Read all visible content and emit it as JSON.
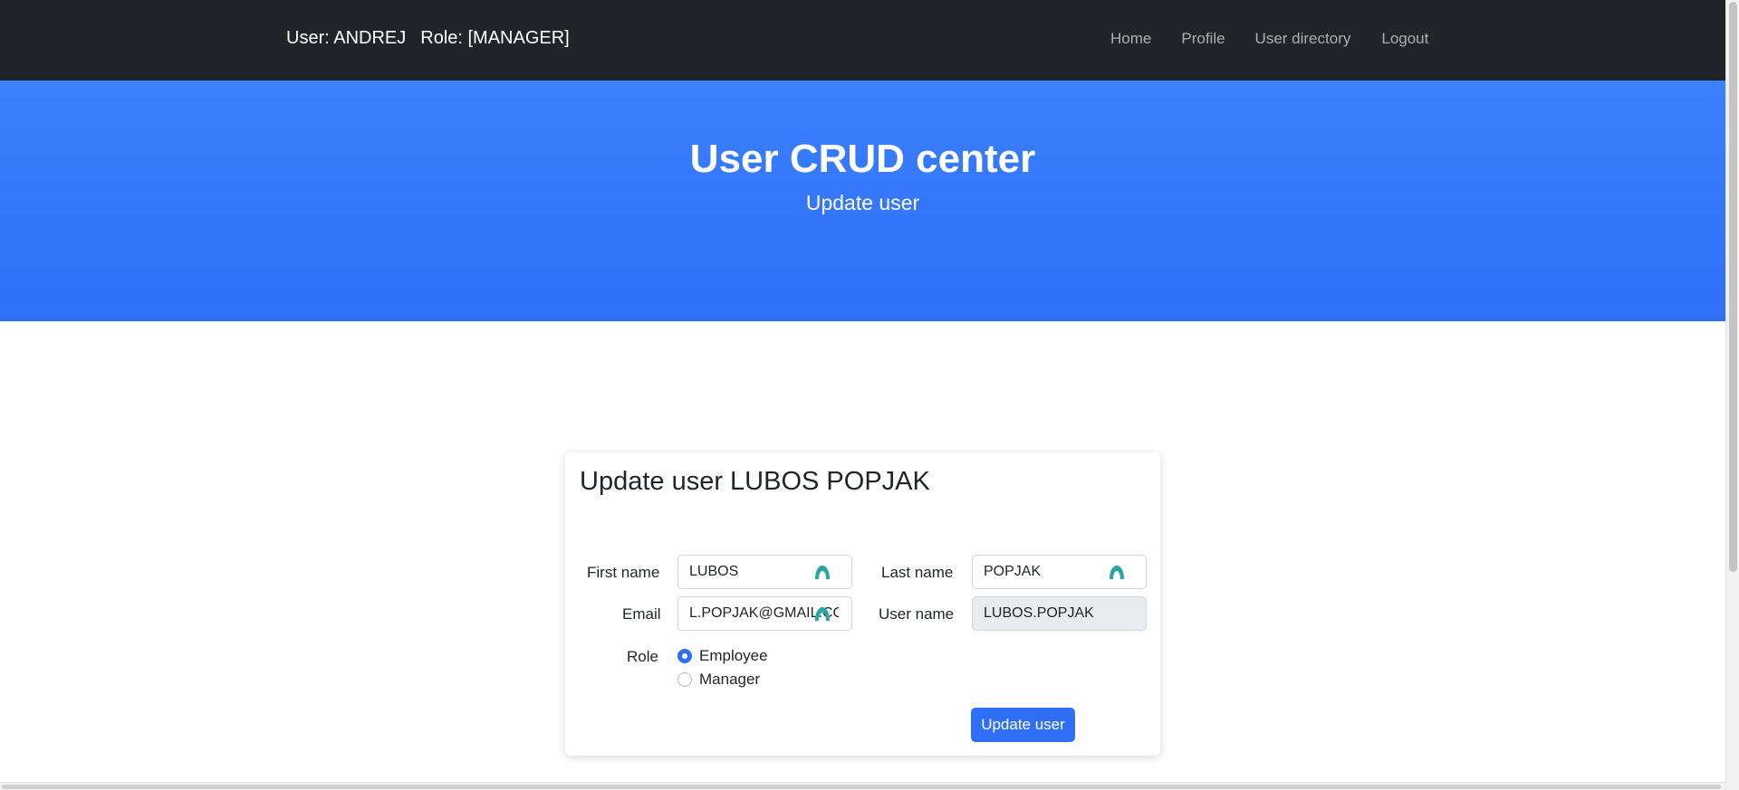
{
  "navbar": {
    "user_text": "User: ANDREJ",
    "role_text": "Role: [MANAGER]",
    "links": [
      "Home",
      "Profile",
      "User directory",
      "Logout"
    ]
  },
  "hero": {
    "title": "User CRUD center",
    "subtitle": "Update user"
  },
  "form": {
    "title": "Update user LUBOS POPJAK",
    "first_name_label": "First name",
    "first_name_value": "LUBOS",
    "last_name_label": "Last name",
    "last_name_value": "POPJAK",
    "email_label": "Email",
    "email_value": "L.POPJAK@GMAIL.COM",
    "username_label": "User name",
    "username_value": "LUBOS.POPJAK",
    "role_label": "Role",
    "role_options": [
      "Employee",
      "Manager"
    ],
    "selected_role": "Employee",
    "submit_label": "Update user"
  },
  "colors": {
    "navbar_bg": "#212529",
    "hero_bg": "#3a80ff",
    "accent": "#2f6ff6",
    "password_manager_icon": "#2aa5a5"
  },
  "icons": [
    "password-manager-icon"
  ]
}
